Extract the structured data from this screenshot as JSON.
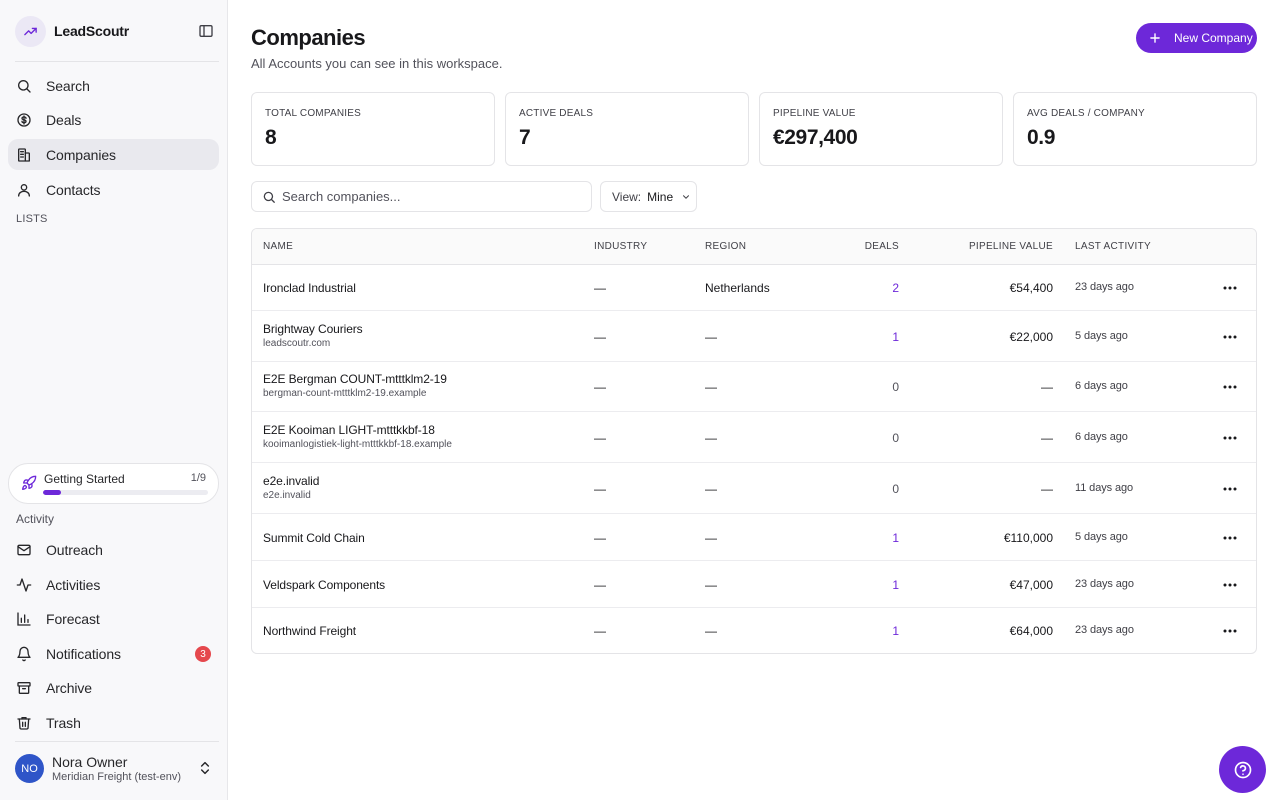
{
  "sidebar": {
    "brand": "LeadScoutr",
    "nav": [
      {
        "label": "Search",
        "icon": "search-icon"
      },
      {
        "label": "Deals",
        "icon": "dollar-icon"
      },
      {
        "label": "Companies",
        "icon": "building-icon",
        "active": true
      },
      {
        "label": "Contacts",
        "icon": "user-icon"
      }
    ],
    "lists_label": "LISTS",
    "getting_started": {
      "label": "Getting Started",
      "count": "1/9",
      "progress": 0.111
    },
    "activity_label": "Activity",
    "activity_nav": [
      {
        "label": "Outreach",
        "icon": "mail-icon"
      },
      {
        "label": "Activities",
        "icon": "activity-icon"
      },
      {
        "label": "Forecast",
        "icon": "bar-chart-icon"
      },
      {
        "label": "Notifications",
        "icon": "bell-icon",
        "badge": "3"
      },
      {
        "label": "Archive",
        "icon": "archive-icon"
      },
      {
        "label": "Trash",
        "icon": "trash-icon"
      }
    ],
    "user": {
      "initials": "NO",
      "name": "Nora Owner",
      "org": "Meridian Freight (test-env)"
    }
  },
  "header": {
    "title": "Companies",
    "subtitle": "All Accounts you can see in this workspace.",
    "new_button": "New Company"
  },
  "stats": [
    {
      "label": "TOTAL COMPANIES",
      "value": "8"
    },
    {
      "label": "ACTIVE DEALS",
      "value": "7"
    },
    {
      "label": "PIPELINE VALUE",
      "value": "€297,400"
    },
    {
      "label": "AVG DEALS / COMPANY",
      "value": "0.9"
    }
  ],
  "filters": {
    "search_placeholder": "Search companies...",
    "view_label": "View:",
    "view_value": "Mine"
  },
  "table": {
    "columns": [
      "NAME",
      "INDUSTRY",
      "REGION",
      "DEALS",
      "PIPELINE VALUE",
      "LAST ACTIVITY"
    ],
    "rows": [
      {
        "name": "Ironclad Industrial",
        "domain": "",
        "industry": "—",
        "region": "Netherlands",
        "deals": "2",
        "pipeline": "€54,400",
        "activity": "23 days ago"
      },
      {
        "name": "Brightway Couriers",
        "domain": "leadscoutr.com",
        "industry": "—",
        "region": "—",
        "deals": "1",
        "pipeline": "€22,000",
        "activity": "5 days ago"
      },
      {
        "name": "E2E Bergman COUNT-mtttklm2-19",
        "domain": "bergman-count-mtttklm2-19.example",
        "industry": "—",
        "region": "—",
        "deals": "0",
        "pipeline": "—",
        "activity": "6 days ago"
      },
      {
        "name": "E2E Kooiman LIGHT-mtttkkbf-18",
        "domain": "kooimanlogistiek-light-mtttkkbf-18.example",
        "industry": "—",
        "region": "—",
        "deals": "0",
        "pipeline": "—",
        "activity": "6 days ago"
      },
      {
        "name": "e2e.invalid",
        "domain": "e2e.invalid",
        "industry": "—",
        "region": "—",
        "deals": "0",
        "pipeline": "—",
        "activity": "11 days ago"
      },
      {
        "name": "Summit Cold Chain",
        "domain": "",
        "industry": "—",
        "region": "—",
        "deals": "1",
        "pipeline": "€110,000",
        "activity": "5 days ago"
      },
      {
        "name": "Veldspark Components",
        "domain": "",
        "industry": "—",
        "region": "—",
        "deals": "1",
        "pipeline": "€47,000",
        "activity": "23 days ago"
      },
      {
        "name": "Northwind Freight",
        "domain": "",
        "industry": "—",
        "region": "—",
        "deals": "1",
        "pipeline": "€64,000",
        "activity": "23 days ago"
      }
    ]
  },
  "colors": {
    "accent": "#6d28d9",
    "badge": "#e5484d",
    "avatar": "#2f55c8"
  }
}
